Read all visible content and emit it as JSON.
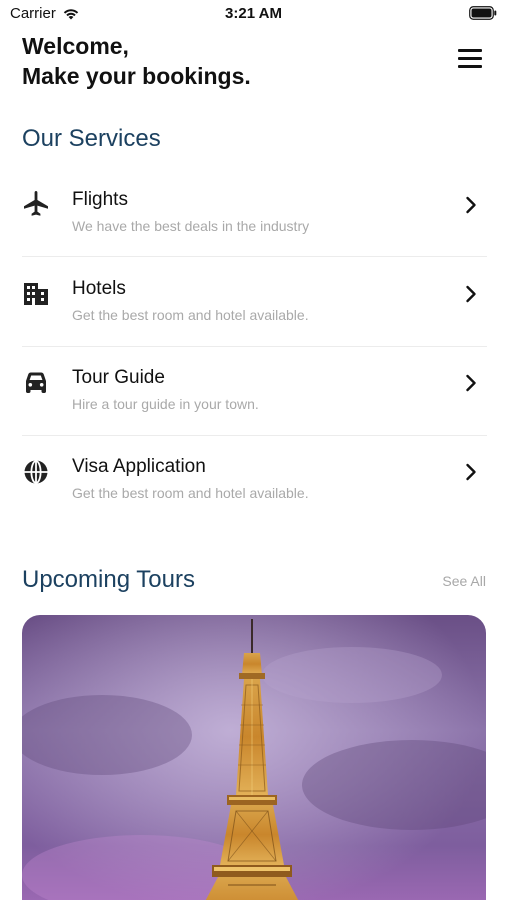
{
  "status_bar": {
    "carrier": "Carrier",
    "time": "3:21 AM"
  },
  "header": {
    "line1": "Welcome,",
    "line2": "Make your bookings."
  },
  "services": {
    "title": "Our Services",
    "items": [
      {
        "icon": "airplane-icon",
        "label": "Flights",
        "subtitle": "We have the best deals in the industry"
      },
      {
        "icon": "building-icon",
        "label": "Hotels",
        "subtitle": "Get the best room and hotel available."
      },
      {
        "icon": "car-icon",
        "label": "Tour Guide",
        "subtitle": "Hire a tour guide in your town."
      },
      {
        "icon": "globe-icon",
        "label": "Visa Application",
        "subtitle": "Get the best room and hotel available."
      }
    ]
  },
  "tours": {
    "title": "Upcoming Tours",
    "see_all": "See All"
  },
  "colors": {
    "section_title": "#1c4160",
    "subtitle": "#a9a9a9",
    "see_all": "#a8a8a8"
  }
}
